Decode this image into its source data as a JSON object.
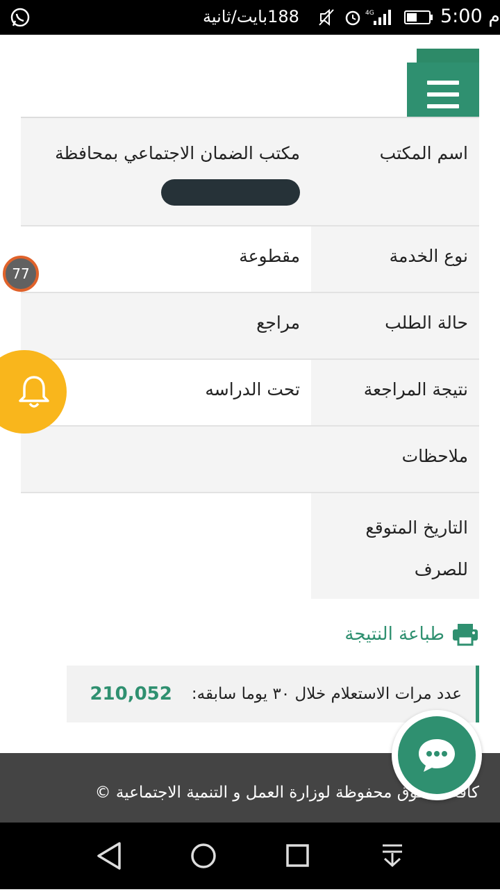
{
  "status_bar": {
    "time": "5:00",
    "am_pm": "م",
    "net_speed": "188بايت/ثانية",
    "network_type": "4G",
    "icons": [
      "whatsapp-icon",
      "mute-icon",
      "alarm-icon",
      "signal-icon",
      "battery-icon"
    ]
  },
  "details": {
    "rows": [
      {
        "label": "اسم المكتب",
        "value": "مكتب الضمان الاجتماعي بمحافظة"
      },
      {
        "label": "نوع الخدمة",
        "value": "مقطوعة"
      },
      {
        "label": "حالة الطلب",
        "value": "مراجع"
      },
      {
        "label": "نتيجة المراجعة",
        "value": "تحت الدراسه"
      },
      {
        "label": "ملاحظات",
        "value": ""
      },
      {
        "label": "التاريخ المتوقع للصرف",
        "value": ""
      }
    ]
  },
  "print_label": "طباعة النتيجة",
  "counter": {
    "text": "عدد مرات الاستعلام خلال ٣٠ يوما سابقه:",
    "value": "210,052"
  },
  "footer_text": "كافة الحقوق محفوظة لوزارة العمل و التنمية الاجتماعية ©",
  "floating_badge": "77",
  "colors": {
    "primary": "#2f9070",
    "bell": "#f9b61c",
    "footer": "#444444"
  }
}
